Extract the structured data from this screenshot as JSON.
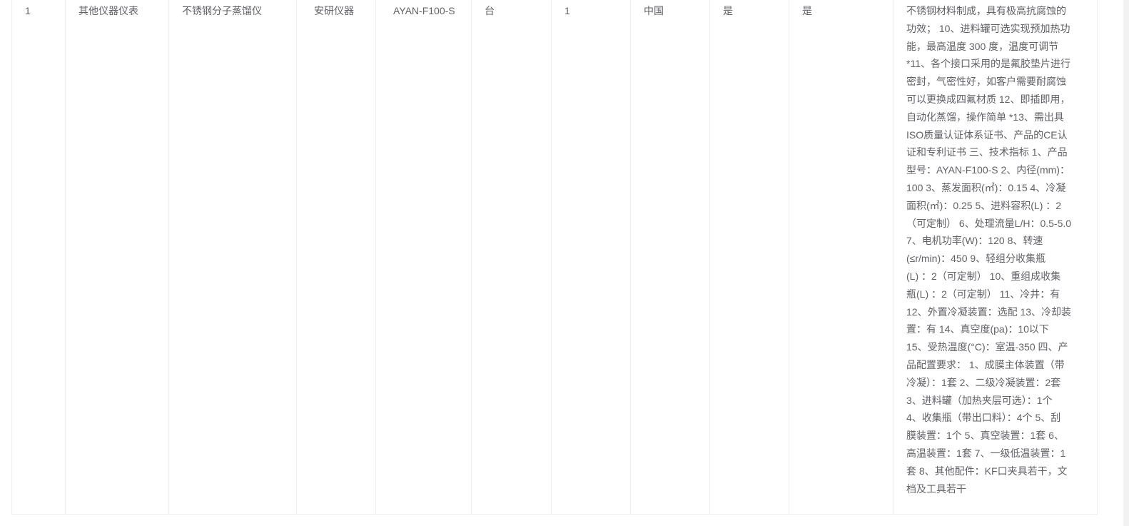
{
  "row": {
    "index": "1",
    "category": "其他仪器仪表",
    "name": "不锈钢分子蒸馏仪",
    "brand": "安研仪器",
    "model": "AYAN-F100-S",
    "unit": "台",
    "quantity": "1",
    "origin": "中国",
    "flag_a": "是",
    "flag_b": "是",
    "description": "不锈钢材料制成，具有极高抗腐蚀的功效； 10、进料罐可选实现预加热功能，最高温度 300 度，温度可调节 *11、各个接口采用的是氟胶垫片进行密封，气密性好，如客户需要耐腐蚀可以更换成四氟材质 12、即插即用，自动化蒸馏，操作简单 *13、需出具ISO质量认证体系证书、产品的CE认证和专利证书 三、技术指标 1、产品型号：AYAN-F100-S 2、内径(mm)：100 3、蒸发面积(㎡)：0.15 4、冷凝面积(㎡)：0.25 5、进料容积(L) ：2 （可定制） 6、处理流量L/H：0.5-5.0 7、电机功率(W)：120 8、转速(≤r/min)：450 9、轻组分收集瓶(L) ：2（可定制） 10、重组成收集瓶(L) ：2（可定制） 11、冷井：有 12、外置冷凝装置：选配 13、冷却装置：有 14、真空度(pa)：10以下 15、受热温度(°C)：室温-350 四、产品配置要求： 1、成膜主体装置（带冷凝）：1套 2、二级冷凝装置：2套 3、进料罐（加热夹层可选）：1个 4、收集瓶（带出口料）：4个 5、刮膜装置：1个 5、真空装置：1套 6、高温装置：1套 7、一级低温装置：1套 8、其他配件：KF口夹具若干，文档及工具若干",
    "description_lines": [
      "不锈钢材料制成，具有极高抗腐蚀的",
      "功效； 10、进料罐可选实现预加热功",
      "能，最高温度 300 度，温度可调节",
      "*11、各个接口采用的是氟胶垫片进行",
      "密封，气密性好，如客户需要耐腐蚀",
      "可以更换成四氟材质 12、即插即用，",
      "自动化蒸馏，操作简单 *13、需出具",
      "ISO质量认证体系证书、产品的CE认",
      "证和专利证书 三、技术指标 1、产品",
      "型号：AYAN-F100-S 2、内径(mm)：",
      "100 3、蒸发面积(㎡)：0.15 4、冷凝",
      "面积(㎡)：0.25 5、进料容积(L) ：2",
      "（可定制） 6、处理流量L/H：0.5-5.0",
      "7、电机功率(W)：120 8、转速",
      "(≤r/min)：450 9、轻组分收集瓶",
      "(L) ：2（可定制） 10、重组成收集",
      "瓶(L) ：2（可定制） 11、冷井：有",
      "12、外置冷凝装置：选配 13、冷却装",
      "置：有 14、真空度(pa)：10以下",
      "15、受热温度(°C)：室温-350 四、产",
      "品配置要求： 1、成膜主体装置（带",
      "冷凝）：1套 2、二级冷凝装置：2套",
      "3、进料罐（加热夹层可选）：1个",
      "4、收集瓶（带出口料）：4个 5、刮",
      "膜装置：1个 5、真空装置：1套 6、",
      "高温装置：1套 7、一级低温装置：1",
      "套 8、其他配件：KF口夹具若干，文",
      "档及工具若干"
    ]
  }
}
